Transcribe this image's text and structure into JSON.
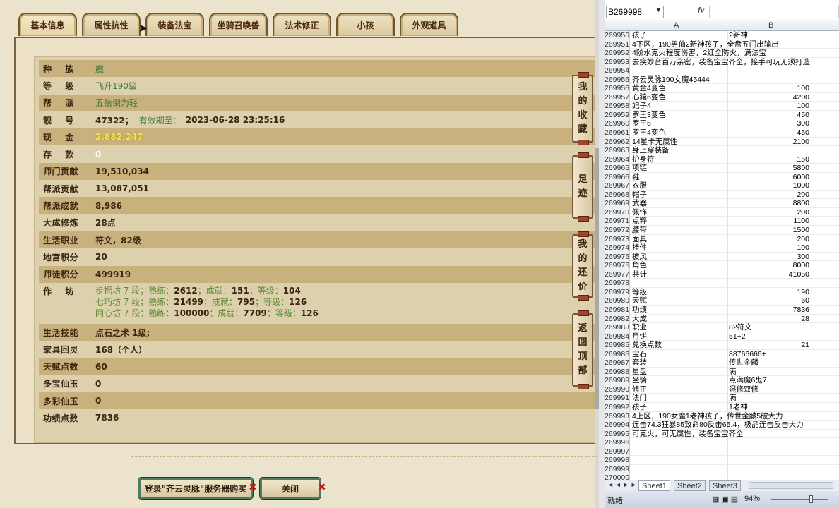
{
  "game": {
    "tabs": [
      "基本信息",
      "属性抗性",
      "装备法宝",
      "坐骑召唤兽",
      "法术修正",
      "小孩",
      "外观道具"
    ],
    "active_tab": 0,
    "rows": [
      {
        "label": "种    族",
        "value": "魔",
        "style": "green"
      },
      {
        "label": "等    级",
        "value": "飞升190级",
        "style": "green"
      },
      {
        "label": "帮    派",
        "value": "五岳倒为轻",
        "style": "green"
      },
      {
        "label": "靓    号",
        "value": "47322；",
        "extra_note": "有效期至：",
        "extra": "2023-06-28 23:25:16",
        "style": "bold"
      },
      {
        "label": "现    金",
        "value": "2,882,247",
        "style": "gold"
      },
      {
        "label": "存    款",
        "value": "0",
        "style": "white"
      },
      {
        "label": "师门贡献",
        "value": "19,510,034",
        "style": "bold"
      },
      {
        "label": "帮派贡献",
        "value": "13,087,051",
        "style": "bold"
      },
      {
        "label": "帮派成就",
        "value": "8,986",
        "style": "bold"
      },
      {
        "label": "大成修炼",
        "value": "28点",
        "style": "bold"
      },
      {
        "label": "生活职业",
        "value": "符文，82级",
        "style": "bold"
      },
      {
        "label": "地宫积分",
        "value": "20",
        "style": "bold"
      },
      {
        "label": "师徒积分",
        "value": "499919",
        "style": "bold"
      }
    ],
    "workshop": {
      "label": "作    坊",
      "lines": [
        {
          "name": "步摇坊 7 段",
          "sep1": "；熟练：",
          "skill": "2612",
          "sep2": "；成就：",
          "ach": "151",
          "sep3": "；等级：",
          "lvl": "104"
        },
        {
          "name": "七巧坊 7 段",
          "sep1": "；熟练：",
          "skill": "21499",
          "sep2": "；成就：",
          "ach": "795",
          "sep3": "；等级：",
          "lvl": "126"
        },
        {
          "name": "同心坊 7 段",
          "sep1": "；熟练：",
          "skill": "100000",
          "sep2": "；成就：",
          "ach": "7709",
          "sep3": "；等级：",
          "lvl": "126"
        }
      ]
    },
    "rows2": [
      {
        "label": "生活技能",
        "value": "点石之术 1级;",
        "style": "bold"
      },
      {
        "label": "家具回灵",
        "value": "168（个人）",
        "style": "bold"
      },
      {
        "label": "天赋点数",
        "value": "60",
        "style": "bold"
      },
      {
        "label": "多宝仙玉",
        "value": "0",
        "style": "bold"
      },
      {
        "label": "多彩仙玉",
        "value": "0",
        "style": "bold"
      },
      {
        "label": "功绩点数",
        "value": "7836",
        "style": "bold"
      }
    ],
    "side_buttons": [
      "我的收藏",
      "足迹",
      "我的还价",
      "返回顶部"
    ],
    "buy_button": "登录\"齐云灵脉\"服务器购买",
    "close_button": "关闭",
    "close_x": "✖"
  },
  "excel": {
    "namebox": "B269998",
    "fx": "fx",
    "columns": [
      "A",
      "B"
    ],
    "rows": [
      {
        "n": "269950",
        "a": "孩子",
        "b": "2新神",
        "b_left": true
      },
      {
        "n": "269951",
        "a": "4下区，190男仙2新神孩子，全盘五门出输出"
      },
      {
        "n": "269952",
        "a": "4阶水克火程度伤害，2红全防火，满法宝"
      },
      {
        "n": "269953",
        "a": "去疾妙音百万亲密，装备宝宝齐全，接手可玩无须打造"
      },
      {
        "n": "269954",
        "a": ""
      },
      {
        "n": "269955",
        "a": "齐云灵脉190女魔45444"
      },
      {
        "n": "269956",
        "a": "黄金4变色",
        "b": "100"
      },
      {
        "n": "269957",
        "a": "心猿6变色",
        "b": "4200"
      },
      {
        "n": "269958",
        "a": "妃子4",
        "b": "100"
      },
      {
        "n": "269959",
        "a": "罗王3变色",
        "b": "450"
      },
      {
        "n": "269960",
        "a": "罗王6",
        "b": "300"
      },
      {
        "n": "269961",
        "a": "罗王4变色",
        "b": "450"
      },
      {
        "n": "269962",
        "a": "14星卡无属性",
        "b": "2100"
      },
      {
        "n": "269963",
        "a": "身上穿装备"
      },
      {
        "n": "269964",
        "a": "护身符",
        "b": "150"
      },
      {
        "n": "269965",
        "a": "项链",
        "b": "5800"
      },
      {
        "n": "269966",
        "a": "鞋",
        "b": "6000"
      },
      {
        "n": "269967",
        "a": "衣服",
        "b": "1000"
      },
      {
        "n": "269968",
        "a": "帽子",
        "b": "200"
      },
      {
        "n": "269969",
        "a": "武器",
        "b": "8800"
      },
      {
        "n": "269970",
        "a": "佩饰",
        "b": "200"
      },
      {
        "n": "269971",
        "a": "点粹",
        "b": "1100"
      },
      {
        "n": "269972",
        "a": "腰带",
        "b": "1500"
      },
      {
        "n": "269973",
        "a": "面具",
        "b": "200"
      },
      {
        "n": "269974",
        "a": "挂件",
        "b": "100"
      },
      {
        "n": "269975",
        "a": "披风",
        "b": "300"
      },
      {
        "n": "269976",
        "a": "角色",
        "b": "8000"
      },
      {
        "n": "269977",
        "a": "共计",
        "b": "41050"
      },
      {
        "n": "269978",
        "a": ""
      },
      {
        "n": "269979",
        "a": "等级",
        "b": "190"
      },
      {
        "n": "269980",
        "a": "天赋",
        "b": "60"
      },
      {
        "n": "269981",
        "a": "功绩",
        "b": "7836"
      },
      {
        "n": "269982",
        "a": "大成",
        "b": "28"
      },
      {
        "n": "269983",
        "a": "职业",
        "b": "82符文",
        "b_left": true
      },
      {
        "n": "269984",
        "a": "月饼",
        "b": "51+2",
        "b_left": true
      },
      {
        "n": "269985",
        "a": "兑换点数",
        "b": "21"
      },
      {
        "n": "269986",
        "a": "宝石",
        "b": "88766666+",
        "b_left": true
      },
      {
        "n": "269987",
        "a": "套装",
        "b": "传世金麟",
        "b_left": true
      },
      {
        "n": "269988",
        "a": "星盘",
        "b": "满",
        "b_left": true
      },
      {
        "n": "269989",
        "a": "坐骑",
        "b": "点满魔6鬼7",
        "b_left": true
      },
      {
        "n": "269990",
        "a": "修正",
        "b": "混修双修",
        "b_left": true
      },
      {
        "n": "269991",
        "a": "法门",
        "b": "满",
        "b_left": true
      },
      {
        "n": "269992",
        "a": "孩子",
        "b": "1老神",
        "b_left": true
      },
      {
        "n": "269993",
        "a": "4上区，190女魔1老神孩子，传世金麟5破大力"
      },
      {
        "n": "269994",
        "a": "连击74.3狂暴85致命80反击65.4，极品连击反击大力"
      },
      {
        "n": "269995",
        "a": "可克火，可无属性，装备宝宝齐全"
      },
      {
        "n": "269996",
        "a": ""
      },
      {
        "n": "269997",
        "a": ""
      },
      {
        "n": "269998",
        "a": ""
      },
      {
        "n": "269999",
        "a": ""
      },
      {
        "n": "270000",
        "a": ""
      }
    ],
    "sheets": [
      "Sheet1",
      "Sheet2",
      "Sheet3"
    ],
    "status": "就绪",
    "zoom": "94%"
  }
}
